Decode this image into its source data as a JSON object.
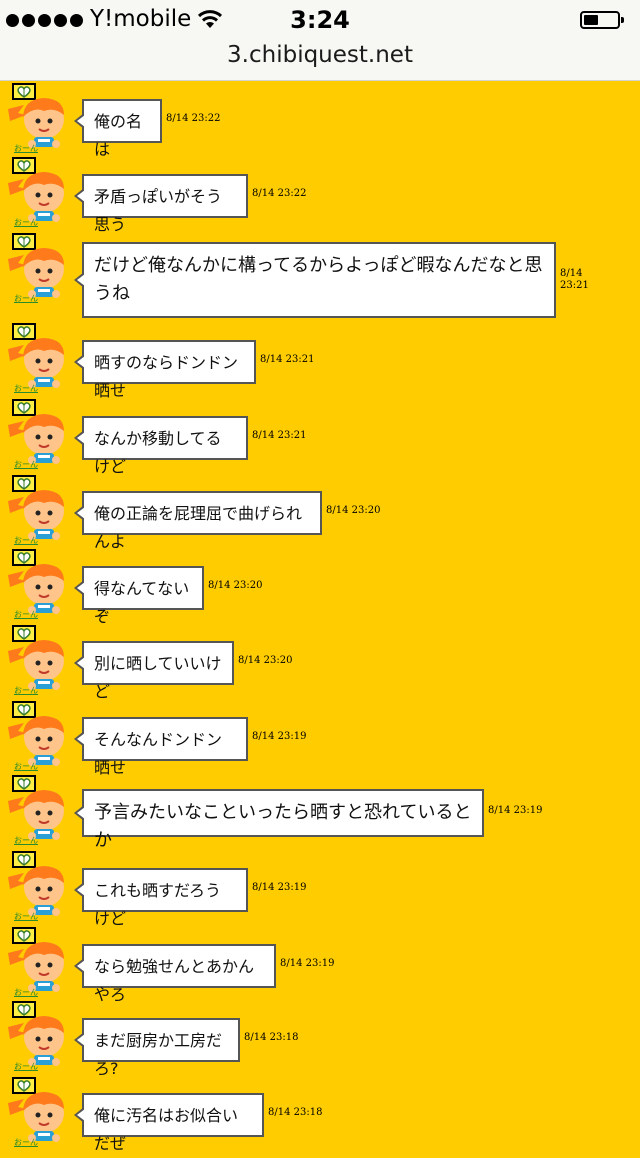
{
  "status": {
    "carrier": "Y!mobile",
    "time": "3:24",
    "url": "3.chibiquest.net"
  },
  "avatar_link": "おーん",
  "messages": [
    {
      "text": "俺の名は",
      "time": "8/14 23:22"
    },
    {
      "text": "矛盾っぽいがそう思う",
      "time": "8/14 23:22"
    },
    {
      "text": "だけど俺なんかに構ってるからよっぽど暇なんだなと思うね",
      "time": "8/14 23:21"
    },
    {
      "text": "晒すのならドンドン晒せ",
      "time": "8/14 23:21"
    },
    {
      "text": "なんか移動してるけど",
      "time": "8/14 23:21"
    },
    {
      "text": "俺の正論を屁理屈で曲げられんよ",
      "time": "8/14 23:20"
    },
    {
      "text": "得なんてないぞ",
      "time": "8/14 23:20"
    },
    {
      "text": "別に晒していいけど",
      "time": "8/14 23:20"
    },
    {
      "text": "そんなんドンドン晒せ",
      "time": "8/14 23:19"
    },
    {
      "text": "予言みたいなこといったら晒すと恐れているとか",
      "time": "8/14 23:19"
    },
    {
      "text": "これも晒すだろうけど",
      "time": "8/14 23:19"
    },
    {
      "text": "なら勉強せんとあかんやろ",
      "time": "8/14 23:19"
    },
    {
      "text": "まだ厨房か工房だろ?",
      "time": "8/14 23:18"
    },
    {
      "text": "俺に汚名はお似合いだぜ",
      "time": "8/14 23:18"
    }
  ]
}
